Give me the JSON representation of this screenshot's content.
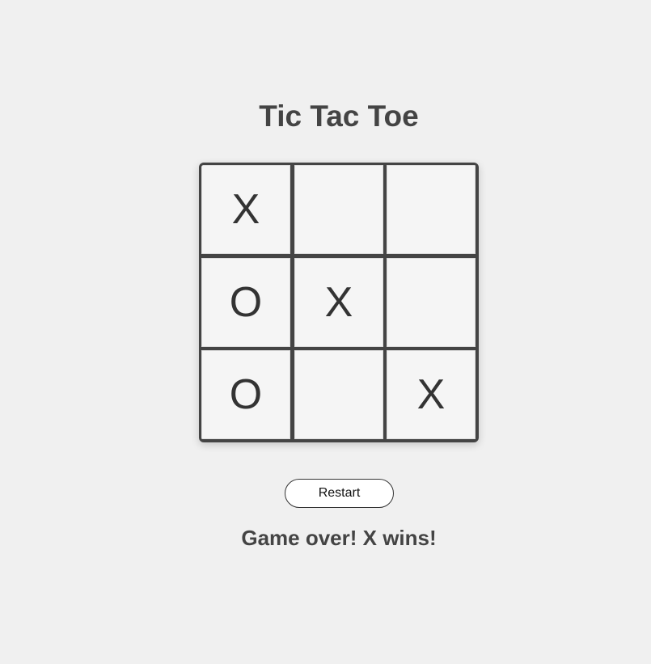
{
  "title": "Tic Tac Toe",
  "board": {
    "cells": [
      "X",
      "",
      "",
      "O",
      "X",
      "",
      "O",
      "",
      "X"
    ]
  },
  "restart_label": "Restart",
  "status": "Game over! X wins!",
  "colors": {
    "background": "#f0f0f0",
    "board_border": "#444444",
    "cell_background": "#f5f5f5",
    "text": "#444444",
    "mark": "#333333"
  }
}
